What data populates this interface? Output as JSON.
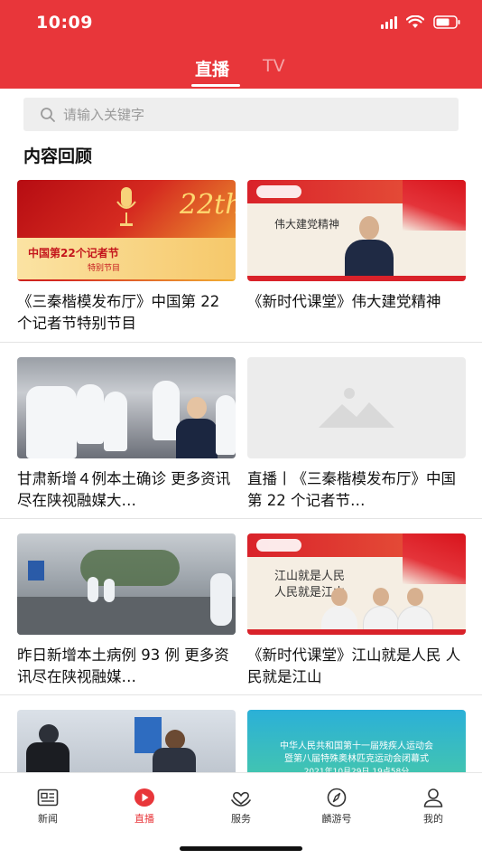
{
  "status_bar": {
    "time": "10:09"
  },
  "header": {
    "tabs": [
      {
        "label": "直播",
        "active": true
      },
      {
        "label": "TV",
        "active": false
      }
    ],
    "background_color": "#e8363a"
  },
  "search": {
    "placeholder": "请输入关键字"
  },
  "section": {
    "title": "内容回顾"
  },
  "cards": [
    {
      "title": "《三秦楷模发布厅》中国第 22 个记者节特别节目",
      "thumb_text": {
        "banner": "中国第22个记者节",
        "subtitle": "特别节目",
        "number": "22th"
      }
    },
    {
      "title": "《新时代课堂》伟大建党精神",
      "thumb_text": {
        "heading": "伟大建党精神"
      }
    },
    {
      "title": "甘肃新增４例本土确诊 更多资讯尽在陕视融媒大…",
      "thumb_text": {}
    },
    {
      "title": "直播丨《三秦楷模发布厅》中国第 22 个记者节…",
      "thumb_text": {}
    },
    {
      "title": "昨日新增本土病例 93 例 更多资讯尽在陕视融媒…",
      "thumb_text": {}
    },
    {
      "title": "《新时代课堂》江山就是人民 人民就是江山",
      "thumb_text": {
        "line1": "江山就是人民",
        "line2": "人民就是江山"
      }
    },
    {
      "title": "",
      "thumb_text": {}
    },
    {
      "title": "",
      "thumb_text": {
        "line1": "中华人民共和国第十一届残疾人运动会",
        "line2": "暨第八届特殊奥林匹克运动会闭幕式",
        "line3": "2021年10月29日 19点58分"
      }
    }
  ],
  "tabbar": {
    "items": [
      {
        "label": "新闻",
        "icon": "news-icon",
        "active": false
      },
      {
        "label": "直播",
        "icon": "live-icon",
        "active": true
      },
      {
        "label": "服务",
        "icon": "service-icon",
        "active": false
      },
      {
        "label": "麟游号",
        "icon": "compass-icon",
        "active": false
      },
      {
        "label": "我的",
        "icon": "profile-icon",
        "active": false
      }
    ],
    "active_color": "#e8363a"
  }
}
